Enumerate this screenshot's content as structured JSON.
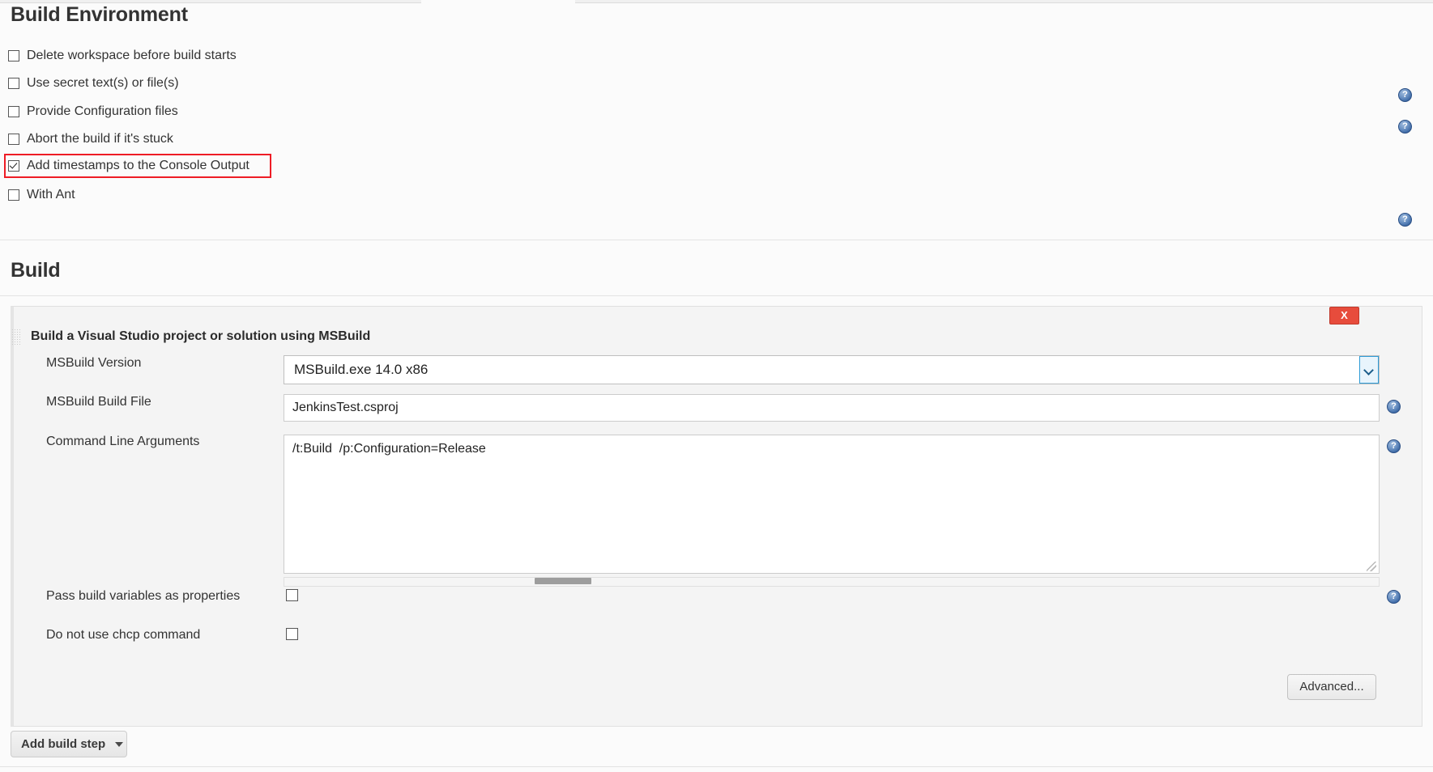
{
  "build_environment": {
    "title": "Build Environment",
    "options": [
      {
        "label": "Delete workspace before build starts",
        "checked": false,
        "help": false
      },
      {
        "label": "Use secret text(s) or file(s)",
        "checked": false,
        "help": true
      },
      {
        "label": "Provide Configuration files",
        "checked": false,
        "help": true
      },
      {
        "label": "Abort the build if it's stuck",
        "checked": false,
        "help": false
      },
      {
        "label": "Add timestamps to the Console Output",
        "checked": true,
        "help": false
      },
      {
        "label": "With Ant",
        "checked": false,
        "help": true
      }
    ],
    "highlight_color": "#ee1c25"
  },
  "build": {
    "title": "Build",
    "step": {
      "heading": "Build a Visual Studio project or solution using MSBuild",
      "delete_label": "X",
      "delete_color": "#e74c3c",
      "fields": {
        "msbuild_version": {
          "label": "MSBuild Version",
          "value": "MSBuild.exe 14.0 x86"
        },
        "msbuild_build_file": {
          "label": "MSBuild Build File",
          "value": "JenkinsTest.csproj",
          "placeholder": ""
        },
        "command_line_arguments": {
          "label": "Command Line Arguments",
          "value": "/t:Build  /p:Configuration=Release",
          "placeholder": ""
        }
      },
      "checkboxes": [
        {
          "label": "Pass build variables as properties",
          "checked": false,
          "help": true
        },
        {
          "label": "Do not use chcp command",
          "checked": false,
          "help": false
        }
      ],
      "advanced_label": "Advanced..."
    },
    "add_build_step_label": "Add build step"
  },
  "icons": {
    "help": "?"
  }
}
